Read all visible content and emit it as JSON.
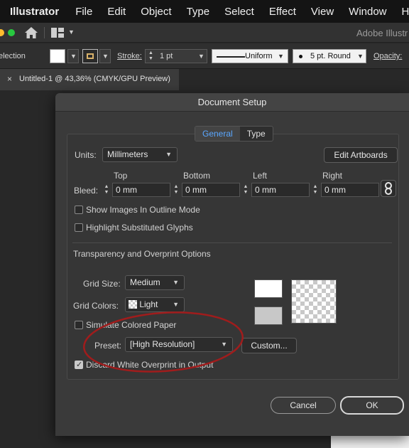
{
  "menubar": {
    "app": "Illustrator",
    "items": [
      "File",
      "Edit",
      "Object",
      "Type",
      "Select",
      "Effect",
      "View",
      "Window",
      "Help"
    ]
  },
  "appbar": {
    "title": "Adobe Illustr"
  },
  "controlbar": {
    "selection_label": "election",
    "stroke_label": "Stroke:",
    "stroke_value": "1 pt",
    "profile_value": "Uniform",
    "brush_value": "5 pt. Round",
    "opacity_label": "Opacity:"
  },
  "doc_tab": {
    "close": "×",
    "title": "Untitled-1 @ 43,36% (CMYK/GPU Preview)"
  },
  "dialog": {
    "title": "Document Setup",
    "tabs": [
      "General",
      "Type"
    ],
    "units_label": "Units:",
    "units_value": "Millimeters",
    "edit_artboards": "Edit Artboards",
    "bleed_label": "Bleed:",
    "bleed": {
      "top_label": "Top",
      "bottom_label": "Bottom",
      "left_label": "Left",
      "right_label": "Right",
      "top": "0 mm",
      "bottom": "0 mm",
      "left": "0 mm",
      "right": "0 mm"
    },
    "show_images_outline": "Show Images In Outline Mode",
    "highlight_glyphs": "Highlight Substituted Glyphs",
    "transparency_heading": "Transparency and Overprint Options",
    "grid_size_label": "Grid Size:",
    "grid_size_value": "Medium",
    "grid_colors_label": "Grid Colors:",
    "grid_colors_value": "Light",
    "simulate_paper": "Simulate Colored Paper",
    "preset_label": "Preset:",
    "preset_value": "[High Resolution]",
    "custom_button": "Custom...",
    "discard_white": "Discard White Overprint in Output",
    "discard_white_checked": true,
    "cancel": "Cancel",
    "ok": "OK"
  },
  "colors": {
    "annotation": "#a01c1c",
    "tab_active": "#5aa7ff"
  }
}
